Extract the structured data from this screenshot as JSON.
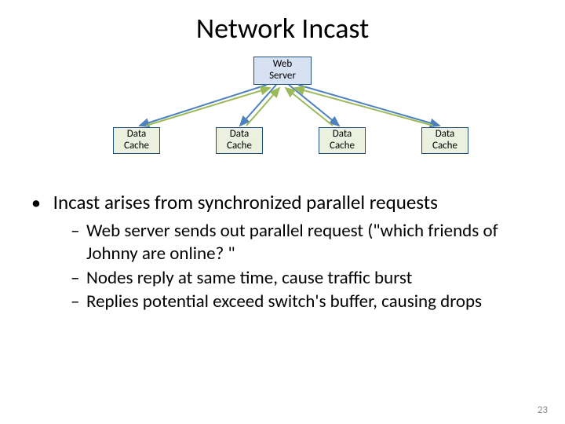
{
  "title": "Network Incast",
  "diagram": {
    "web_server_label": "Web\nServer",
    "cache_label_1": "Data\nCache",
    "cache_label_2": "Data\nCache",
    "cache_label_3": "Data\nCache",
    "cache_label_4": "Data\nCache"
  },
  "bullets": {
    "main": "Incast arises from synchronized parallel requests",
    "sub1": "Web server sends out parallel request (\"which friends of Johnny are online? \"",
    "sub2": "Nodes reply at same time, cause traffic burst",
    "sub3": "Replies potential exceed switch's buffer, causing drops"
  },
  "page_number": "23",
  "colors": {
    "web_server_fill": "#D6E1F1",
    "data_cache_fill": "#EBF1DE",
    "box_border": "#1F4E79",
    "arrow_down": "#4F81BD",
    "arrow_up": "#9BBB59"
  }
}
